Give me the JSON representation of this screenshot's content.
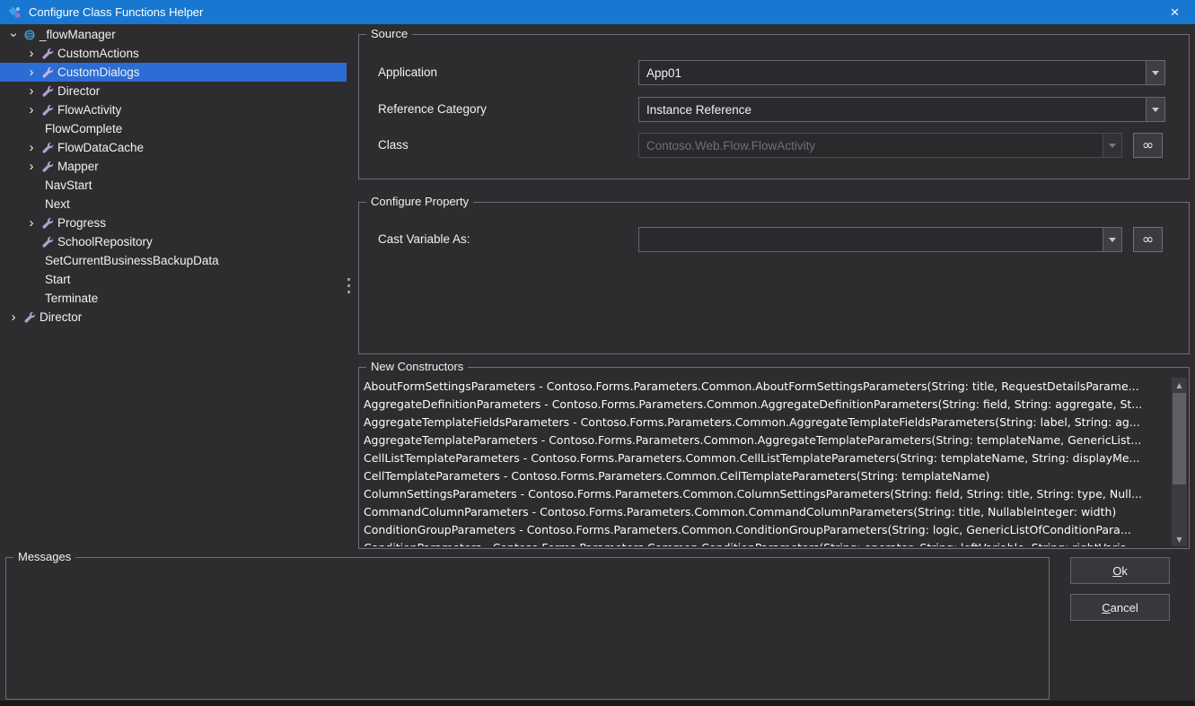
{
  "window": {
    "title": "Configure Class Functions Helper"
  },
  "icons": {
    "close": "×",
    "chevron": "›",
    "link": "∞",
    "scroll_up": "▲",
    "scroll_down": "▼"
  },
  "tree": {
    "selected_item": "CustomDialogs",
    "items": [
      {
        "label": "_flowManager",
        "depth": 0,
        "expanded": true,
        "icon": "namespace",
        "selected": false
      },
      {
        "label": "CustomActions",
        "depth": 1,
        "expanded": false,
        "icon": "method",
        "selected": false
      },
      {
        "label": "CustomDialogs",
        "depth": 1,
        "expanded": false,
        "icon": "method",
        "selected": true
      },
      {
        "label": "Director",
        "depth": 1,
        "expanded": false,
        "icon": "method",
        "selected": false
      },
      {
        "label": "FlowActivity",
        "depth": 1,
        "expanded": false,
        "icon": "method",
        "selected": false
      },
      {
        "label": "FlowComplete",
        "depth": 1,
        "expanded": false,
        "icon": "none",
        "selected": false
      },
      {
        "label": "FlowDataCache",
        "depth": 1,
        "expanded": false,
        "icon": "method",
        "selected": false
      },
      {
        "label": "Mapper",
        "depth": 1,
        "expanded": false,
        "icon": "method",
        "selected": false
      },
      {
        "label": "NavStart",
        "depth": 1,
        "expanded": false,
        "icon": "none",
        "selected": false
      },
      {
        "label": "Next",
        "depth": 1,
        "expanded": false,
        "icon": "none",
        "selected": false
      },
      {
        "label": "Progress",
        "depth": 1,
        "expanded": false,
        "icon": "method",
        "selected": false
      },
      {
        "label": "SchoolRepository",
        "depth": 1,
        "expanded": false,
        "icon": "method",
        "selected": false
      },
      {
        "label": "SetCurrentBusinessBackupData",
        "depth": 1,
        "expanded": false,
        "icon": "none",
        "selected": false
      },
      {
        "label": "Start",
        "depth": 1,
        "expanded": false,
        "icon": "none",
        "selected": false
      },
      {
        "label": "Terminate",
        "depth": 1,
        "expanded": false,
        "icon": "none",
        "selected": false
      },
      {
        "label": "Director",
        "depth": 0,
        "expanded": false,
        "icon": "method",
        "selected": false
      }
    ]
  },
  "source": {
    "title": "Source",
    "application_label": "Application",
    "application_value": "App01",
    "reference_label": "Reference Category",
    "reference_value": "Instance Reference",
    "class_label": "Class",
    "class_value": "Contoso.Web.Flow.FlowActivity"
  },
  "configure": {
    "title": "Configure Property",
    "cast_label": "Cast Variable As:",
    "cast_value": ""
  },
  "constructors": {
    "title": "New Constructors",
    "items": [
      "AboutFormSettingsParameters - Contoso.Forms.Parameters.Common.AboutFormSettingsParameters(String: title, RequestDetailsParame...",
      "AggregateDefinitionParameters - Contoso.Forms.Parameters.Common.AggregateDefinitionParameters(String: field, String: aggregate, St...",
      "AggregateTemplateFieldsParameters - Contoso.Forms.Parameters.Common.AggregateTemplateFieldsParameters(String: label, String: ag...",
      "AggregateTemplateParameters - Contoso.Forms.Parameters.Common.AggregateTemplateParameters(String: templateName, GenericList...",
      "CellListTemplateParameters - Contoso.Forms.Parameters.Common.CellListTemplateParameters(String: templateName, String: displayMe...",
      "CellTemplateParameters - Contoso.Forms.Parameters.Common.CellTemplateParameters(String: templateName)",
      "ColumnSettingsParameters - Contoso.Forms.Parameters.Common.ColumnSettingsParameters(String: field, String: title, String: type, Null...",
      "CommandColumnParameters - Contoso.Forms.Parameters.Common.CommandColumnParameters(String: title, NullableInteger: width)",
      "ConditionGroupParameters - Contoso.Forms.Parameters.Common.ConditionGroupParameters(String: logic, GenericListOfConditionPara...",
      "ConditionParameters - Contoso.Forms.Parameters.Common.ConditionParameters(String: operator, String: leftVariable, String: rightVaria..."
    ]
  },
  "messages": {
    "title": "Messages"
  },
  "actions": {
    "ok": "Ok",
    "cancel": "Cancel"
  }
}
